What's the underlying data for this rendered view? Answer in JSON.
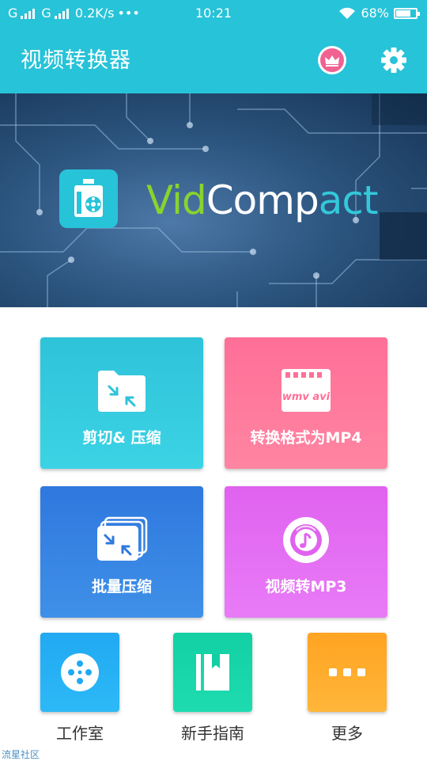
{
  "status_bar": {
    "carrier1": "G",
    "carrier2": "G",
    "speed": "0.2K/s",
    "dots": "•••",
    "time": "10:21",
    "battery": "68%",
    "icons": [
      "signal-icon",
      "wifi-icon",
      "battery-icon"
    ]
  },
  "app_bar": {
    "title": "视频转换器",
    "icons": [
      "crown-icon",
      "gear-icon"
    ]
  },
  "banner": {
    "brand_part1": "Vid",
    "brand_part2": "Comp",
    "brand_part3": "act"
  },
  "cards": [
    {
      "label": "剪切& 压缩",
      "icon": "folder-compress-icon",
      "color": "#2fc3d9"
    },
    {
      "label": "转换格式为MP4",
      "icon": "wmv-avi-film-icon",
      "color": "#ff6f97"
    },
    {
      "label": "批量压缩",
      "icon": "batch-compress-icon",
      "color": "#2f78de"
    },
    {
      "label": "视频转MP3",
      "icon": "music-disc-icon",
      "color": "#e062ef"
    }
  ],
  "film_text": "wmv avi",
  "shortcuts": [
    {
      "label": "工作室",
      "icon": "film-reel-icon",
      "color": "#21a9f2"
    },
    {
      "label": "新手指南",
      "icon": "book-icon",
      "color": "#12d0a3"
    },
    {
      "label": "更多",
      "icon": "more-dots-icon",
      "color": "#ffa322"
    }
  ],
  "watermark": "流星社区",
  "colors": {
    "primary": "#27c3d8",
    "accent_pink": "#f06292"
  }
}
